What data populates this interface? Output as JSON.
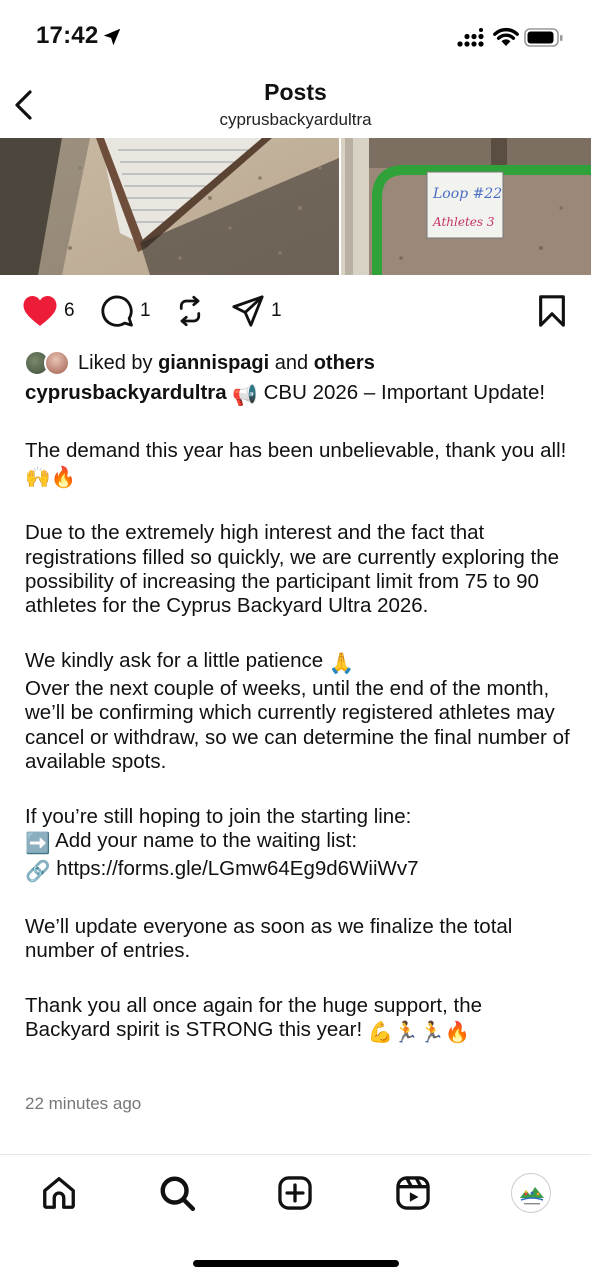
{
  "status_bar": {
    "time": "17:42"
  },
  "header": {
    "title": "Posts",
    "username": "cyprusbackyardultra"
  },
  "media": {
    "left_image": "sign-board-shadow",
    "right_image": "loop-sign-on-rail",
    "sign_text_loop": "Loop #22",
    "sign_text_athletes": "Athletes 3"
  },
  "actions": {
    "like_count": "6",
    "comment_count": "1",
    "share_count": "1",
    "colors": {
      "like": "#ed1d3a"
    }
  },
  "liked_by": {
    "prefix": "Liked by",
    "user": "giannispagi",
    "connector": "and",
    "others": "others"
  },
  "caption": {
    "username": "cyprusbackyardultra",
    "line1_emoji": "📢",
    "line1_text": "CBU 2026 – Important Update!",
    "p2": "The demand this year has been unbelievable, thank you all!",
    "p2_emoji": "🙌🔥",
    "p3": "Due to the extremely high interest and the fact that registrations filled so quickly, we are currently exploring the possibility of increasing the participant limit from 75 to 90 athletes for the Cyprus Backyard Ultra 2026.",
    "p4a": "We kindly ask for a little patience",
    "p4a_emoji": "🙏",
    "p4b": "Over the next couple of weeks, until the end of the month, we’ll be confirming which currently registered athletes may cancel or withdraw, so we can determine the final number of available spots.",
    "p5a": "If you’re still hoping to join the starting line:",
    "p5b_emoji": "➡️",
    "p5b": "Add your name to the waiting list:",
    "p5c_emoji": "🔗",
    "p5c": "https://forms.gle/LGmw64Eg9d6WiiWv7",
    "p6": "We’ll update everyone as soon as we finalize the total number of entries.",
    "p7": "Thank you all once again for the huge support, the Backyard spirit is STRONG this year!",
    "p7_emoji": "💪🏃🏃🔥"
  },
  "timestamp": "22 minutes ago",
  "nav": {
    "items": [
      "home-icon",
      "search-icon",
      "create-icon",
      "reels-icon",
      "profile-avatar"
    ]
  }
}
